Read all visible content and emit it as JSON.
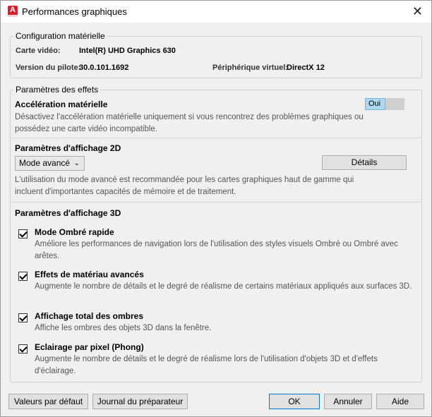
{
  "window": {
    "title": "Performances graphiques",
    "close_glyph": "✕",
    "app_icon_letter": "A"
  },
  "hardware": {
    "legend": "Configuration matérielle",
    "video_card_label": "Carte vidéo:",
    "video_card_value": "Intel(R) UHD Graphics 630",
    "driver_label": "Version du pilote:",
    "driver_value": "30.0.101.1692",
    "virtual_device_label": "Périphérique virtuel:",
    "virtual_device_value": "DirectX 12"
  },
  "effects": {
    "legend": "Paramètres des effets",
    "hw_accel": {
      "title": "Accélération matérielle",
      "toggle_value": "Oui",
      "description": "Désactivez l'accélération matérielle uniquement si vous rencontrez des problèmes graphiques ou possédez une carte vidéo incompatible."
    },
    "display2d": {
      "title": "Paramètres d'affichage 2D",
      "mode_value": "Mode avancé",
      "details_label": "Détails",
      "description": "L'utilisation du mode avancé est recommandée pour les cartes graphiques haut de gamme qui incluent d'importantes capacités de mémoire et de traitement."
    },
    "display3d": {
      "title": "Paramètres d'affichage 3D",
      "options": [
        {
          "title": "Mode Ombré rapide",
          "checked": true,
          "description": "Améliore les performances de navigation lors de l'utilisation des styles visuels Ombré ou Ombré avec arêtes."
        },
        {
          "title": "Effets de matériau avancés",
          "checked": true,
          "description": "Augmente le nombre de détails et le degré de réalisme de certains matériaux appliqués aux surfaces 3D."
        },
        {
          "title": "Affichage total des ombres",
          "checked": true,
          "description": "Affiche les ombres des objets 3D dans la fenêtre."
        },
        {
          "title": "Eclairage par pixel (Phong)",
          "checked": true,
          "description": "Augmente le nombre de détails et le degré de réalisme lors de l'utilisation d'objets 3D et d'effets d'éclairage."
        }
      ]
    }
  },
  "footer": {
    "defaults_label": "Valeurs par défaut",
    "log_label": "Journal du préparateur",
    "ok_label": "OK",
    "cancel_label": "Annuler",
    "help_label": "Aide"
  }
}
